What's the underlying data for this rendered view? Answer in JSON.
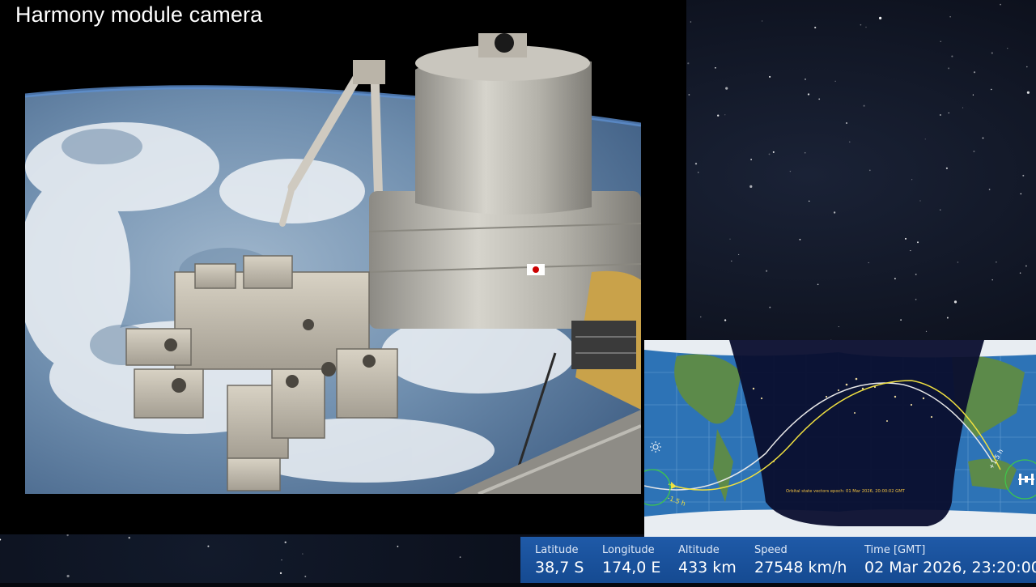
{
  "camera": {
    "title": "Harmony module camera"
  },
  "map": {
    "epoch_note": "Orbital state vectors epoch: 01 Mar 2026, 20:00:02 GMT",
    "marker_minus": "-1.5 h",
    "marker_plus": "+1.5 h"
  },
  "telemetry": {
    "latitude": {
      "label": "Latitude",
      "value": "38,7 S"
    },
    "longitude": {
      "label": "Longitude",
      "value": "174,0 E"
    },
    "altitude": {
      "label": "Altitude",
      "value": "433 km"
    },
    "speed": {
      "label": "Speed",
      "value": "27548 km/h"
    },
    "time": {
      "label": "Time [GMT]",
      "value": "02 Mar 2026, 23:20:00"
    }
  },
  "colors": {
    "telemetry_bar": "#1a54a0",
    "map_ocean": "#2d73b6",
    "night_side": "#0a0e2e",
    "track_white": "#e8e8e8",
    "track_yellow": "#f0e040"
  },
  "icons": [
    "sun-icon",
    "iss-icon"
  ]
}
